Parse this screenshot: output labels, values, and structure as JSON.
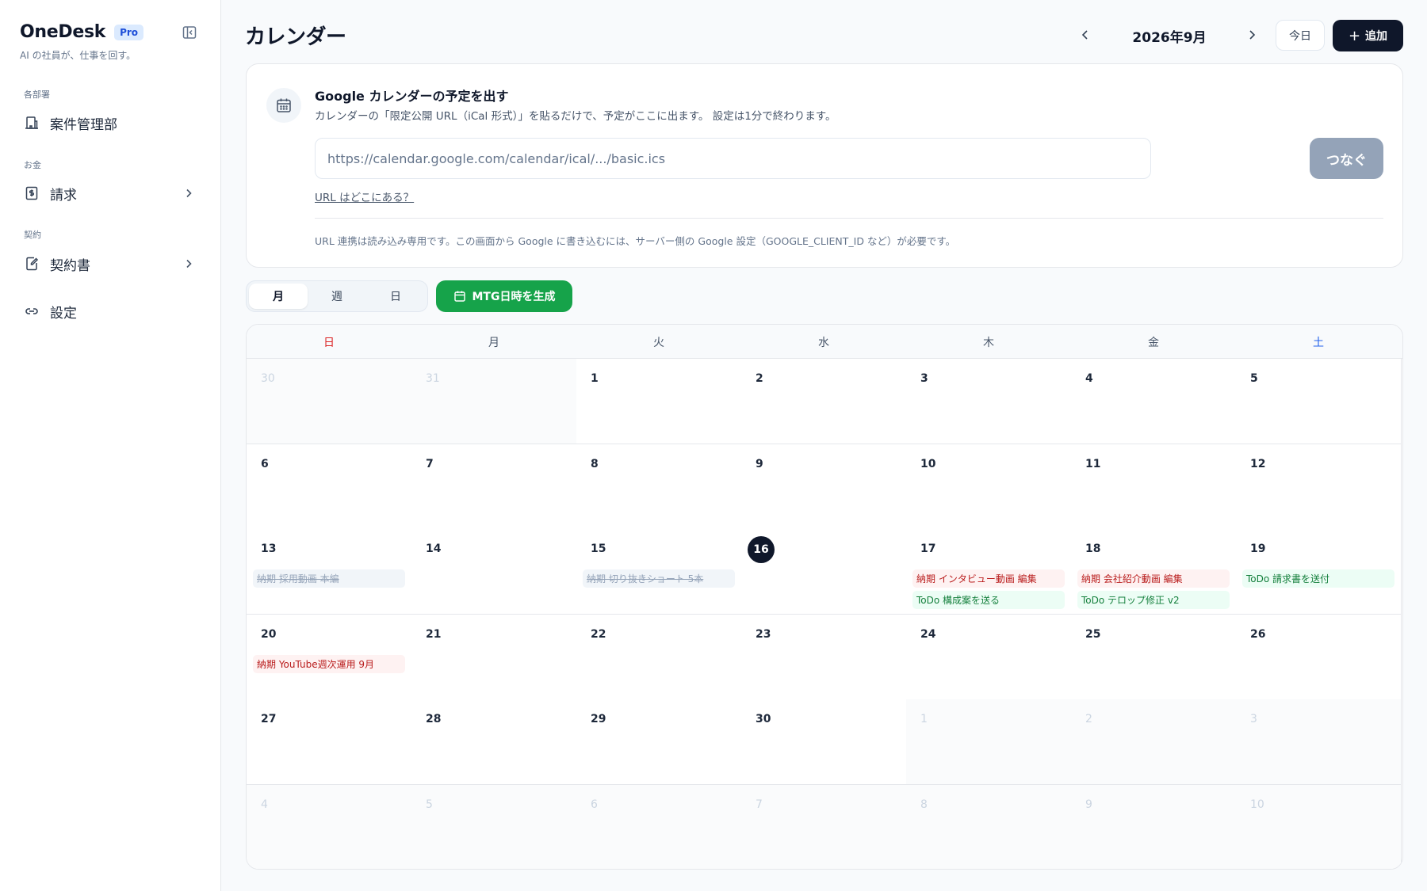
{
  "sidebar": {
    "brand": "OneDesk",
    "badge": "Pro",
    "tagline": "AI の社員が、仕事を回す。",
    "sections": [
      {
        "label": "各部署",
        "item": "案件管理部",
        "icon": "building-icon",
        "chevron": false
      },
      {
        "label": "お金",
        "item": "請求",
        "icon": "invoice-icon",
        "chevron": true
      },
      {
        "label": "契約",
        "item": "契約書",
        "icon": "contract-edit-icon",
        "chevron": true
      }
    ],
    "settings": "設定"
  },
  "header": {
    "title": "カレンダー",
    "month": "2026年9月",
    "today": "今日",
    "add": "追加"
  },
  "google": {
    "title": "Google カレンダーの予定を出す",
    "desc": "カレンダーの「限定公開 URL（iCal 形式）」を貼るだけで、予定がここに出ます。 設定は1分で終わります。",
    "placeholder": "https://calendar.google.com/calendar/ical/.../basic.ics",
    "connect": "つなぐ",
    "link": "URL はどこにある？",
    "note": "URL 連携は読み込み専用です。この画面から Google に書き込むには、サーバー側の Google 設定（GOOGLE_CLIENT_ID など）が必要です。"
  },
  "views": {
    "month": "月",
    "week": "週",
    "day": "日",
    "active": "month",
    "mtg": "MTG日時を生成"
  },
  "calendar": {
    "weekdays": [
      "日",
      "月",
      "火",
      "水",
      "木",
      "金",
      "土"
    ],
    "today": 16,
    "weeks": [
      [
        {
          "d": "30",
          "out": true
        },
        {
          "d": "31",
          "out": true
        },
        {
          "d": "1"
        },
        {
          "d": "2"
        },
        {
          "d": "3"
        },
        {
          "d": "4"
        },
        {
          "d": "5"
        }
      ],
      [
        {
          "d": "6"
        },
        {
          "d": "7"
        },
        {
          "d": "8"
        },
        {
          "d": "9"
        },
        {
          "d": "10"
        },
        {
          "d": "11"
        },
        {
          "d": "12"
        }
      ],
      [
        {
          "d": "13",
          "events": [
            {
              "t": "納期 採用動画 本編",
              "k": "done"
            }
          ]
        },
        {
          "d": "14"
        },
        {
          "d": "15",
          "events": [
            {
              "t": "納期 切り抜きショート 5本",
              "k": "done"
            }
          ]
        },
        {
          "d": "16",
          "today": true
        },
        {
          "d": "17",
          "events": [
            {
              "t": "納期 インタビュー動画 編集",
              "k": "deadline"
            },
            {
              "t": "ToDo 構成案を送る",
              "k": "todo"
            }
          ]
        },
        {
          "d": "18",
          "events": [
            {
              "t": "納期 会社紹介動画 編集",
              "k": "deadline"
            },
            {
              "t": "ToDo テロップ修正 v2",
              "k": "todo"
            }
          ]
        },
        {
          "d": "19",
          "events": [
            {
              "t": "ToDo 請求書を送付",
              "k": "todo"
            }
          ]
        }
      ],
      [
        {
          "d": "20",
          "events": [
            {
              "t": "納期 YouTube週次運用 9月",
              "k": "deadline"
            }
          ]
        },
        {
          "d": "21"
        },
        {
          "d": "22"
        },
        {
          "d": "23"
        },
        {
          "d": "24"
        },
        {
          "d": "25"
        },
        {
          "d": "26"
        }
      ],
      [
        {
          "d": "27"
        },
        {
          "d": "28"
        },
        {
          "d": "29"
        },
        {
          "d": "30"
        },
        {
          "d": "1",
          "out": true
        },
        {
          "d": "2",
          "out": true
        },
        {
          "d": "3",
          "out": true
        }
      ],
      [
        {
          "d": "4",
          "out": true
        },
        {
          "d": "5",
          "out": true
        },
        {
          "d": "6",
          "out": true
        },
        {
          "d": "7",
          "out": true
        },
        {
          "d": "8",
          "out": true
        },
        {
          "d": "9",
          "out": true
        },
        {
          "d": "10",
          "out": true
        }
      ]
    ]
  },
  "colors": {
    "accent": "#0f172a",
    "green": "#16a34a",
    "deadline": "#b91c1c",
    "todo": "#15803d"
  }
}
